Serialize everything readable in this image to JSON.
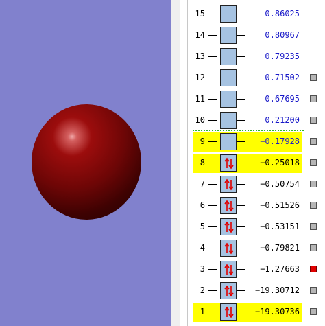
{
  "viewer": {
    "background": "#8181cd",
    "object": "orbital-sphere",
    "object_color": "#8b0a0a"
  },
  "orbitals": [
    {
      "index": "15",
      "energy": "0.86025",
      "occupied": false,
      "highlighted": false,
      "marker": "none"
    },
    {
      "index": "14",
      "energy": "0.80967",
      "occupied": false,
      "highlighted": false,
      "marker": "none"
    },
    {
      "index": "13",
      "energy": "0.79235",
      "occupied": false,
      "highlighted": false,
      "marker": "none"
    },
    {
      "index": "12",
      "energy": "0.71502",
      "occupied": false,
      "highlighted": false,
      "marker": "gray"
    },
    {
      "index": "11",
      "energy": "0.67695",
      "occupied": false,
      "highlighted": false,
      "marker": "gray"
    },
    {
      "index": "10",
      "energy": "0.21200",
      "occupied": false,
      "highlighted": false,
      "marker": "gray"
    },
    {
      "index": "9",
      "energy": "−0.17928",
      "occupied": false,
      "highlighted": true,
      "marker": "gray"
    },
    {
      "index": "8",
      "energy": "−0.25018",
      "occupied": true,
      "highlighted": true,
      "marker": "gray"
    },
    {
      "index": "7",
      "energy": "−0.50754",
      "occupied": true,
      "highlighted": false,
      "marker": "gray"
    },
    {
      "index": "6",
      "energy": "−0.51526",
      "occupied": true,
      "highlighted": false,
      "marker": "gray"
    },
    {
      "index": "5",
      "energy": "−0.53151",
      "occupied": true,
      "highlighted": false,
      "marker": "gray"
    },
    {
      "index": "4",
      "energy": "−0.79821",
      "occupied": true,
      "highlighted": false,
      "marker": "gray"
    },
    {
      "index": "3",
      "energy": "−1.27663",
      "occupied": true,
      "highlighted": false,
      "marker": "red"
    },
    {
      "index": "2",
      "energy": "−19.30712",
      "occupied": true,
      "highlighted": false,
      "marker": "gray"
    },
    {
      "index": "1",
      "energy": "−19.30736",
      "occupied": true,
      "highlighted": true,
      "marker": "gray"
    }
  ],
  "colors": {
    "highlight": "#ffff00",
    "box_fill": "#a6c3e2",
    "virtual_energy": "#1818c8",
    "electron_arrow": "#e00000",
    "homo_lumo_line": "#2db82d"
  }
}
